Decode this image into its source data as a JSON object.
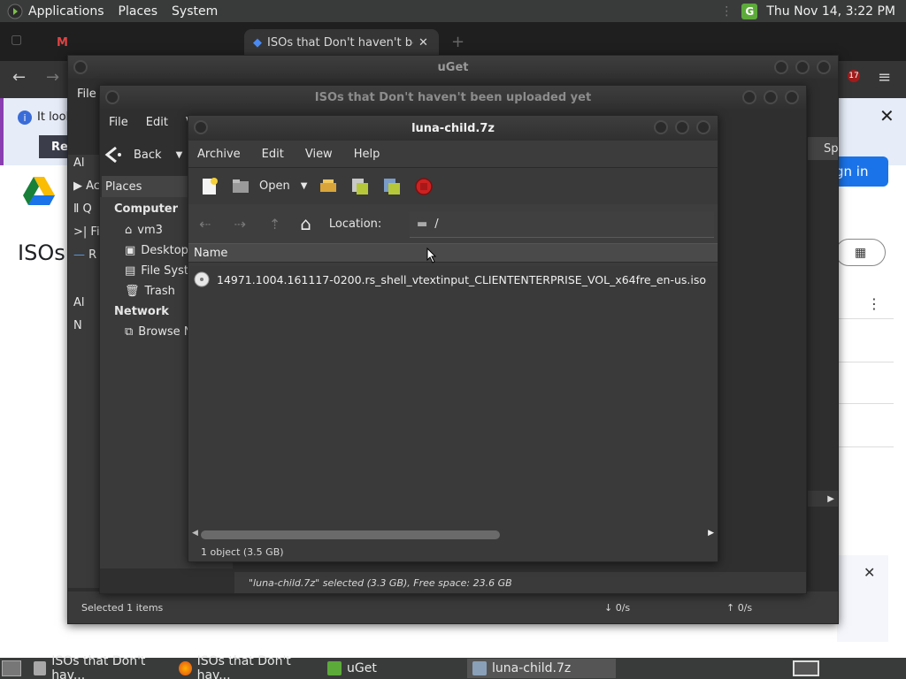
{
  "top_panel": {
    "menus": [
      "Applications",
      "Places",
      "System"
    ],
    "clock": "Thu Nov 14,  3:22 PM"
  },
  "browser": {
    "tabs": [
      {
        "label": "ISOs that Don't haven't bee",
        "active": true
      }
    ],
    "infobar_text": "It look",
    "infobar_button": "Re",
    "signin_label": "gn in",
    "page_title": "ISOs",
    "extension_badge": "17"
  },
  "uget": {
    "title": "uGet",
    "menu": [
      "File"
    ],
    "sidebar_items": [
      "Al",
      "Ac",
      "Q",
      "Fi",
      "R",
      "Al",
      "N"
    ],
    "right_fragment": "Sp",
    "status": "Selected 1 items",
    "download_speed": "0/s",
    "upload_speed": "0/s"
  },
  "isos_window": {
    "title": "ISOs that Don't haven't been uploaded yet",
    "menu": [
      "File",
      "Edit",
      "V"
    ],
    "back_label": "Back",
    "places_label": "Places",
    "sections": [
      {
        "heading": "Computer",
        "items": [
          "vm3",
          "Desktop",
          "File Syst",
          "Trash"
        ]
      },
      {
        "heading": "Network",
        "items": [
          "Browse N"
        ]
      }
    ],
    "status": "\"luna-child.7z\" selected (3.3 GB), Free space: 23.6 GB"
  },
  "archive": {
    "title": "luna-child.7z",
    "menu": [
      "Archive",
      "Edit",
      "View",
      "Help"
    ],
    "open_label": "Open",
    "location_label": "Location:",
    "location_path": "/",
    "column_name": "Name",
    "files": [
      "14971.1004.161117-0200.rs_shell_vtextinput_CLIENTENTERPRISE_VOL_x64fre_en-us.iso"
    ],
    "status": "1 object (3.5 GB)"
  },
  "taskbar": {
    "tasks": [
      {
        "label": "ISOs that Don't hav...",
        "icon": "folder-icon",
        "active": false
      },
      {
        "label": "ISOs that Don't hav...",
        "icon": "firefox-icon",
        "active": false
      },
      {
        "label": "uGet",
        "icon": "uget-icon",
        "active": false
      },
      {
        "label": "luna-child.7z",
        "icon": "archive-manager-icon",
        "active": true
      }
    ]
  },
  "colors": {
    "panel": "#393b3b",
    "window_bg": "#353535",
    "accent_blue": "#1a73e8",
    "uget_green": "#5cab3a",
    "stop_red": "#cc2222"
  }
}
